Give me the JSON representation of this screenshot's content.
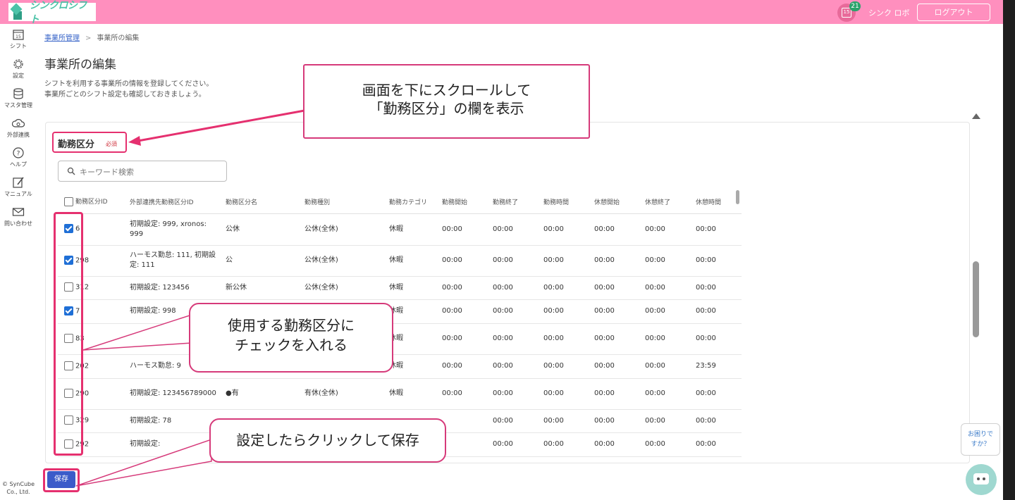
{
  "header": {
    "app_name": "シンクロシフト",
    "notification_count": "21",
    "calendar_day": "15",
    "user_name": "シンク ロボ",
    "logout_label": "ログアウト"
  },
  "sidebar": {
    "items": [
      {
        "label": "シフト",
        "icon": "calendar-icon"
      },
      {
        "label": "設定",
        "icon": "gear-icon"
      },
      {
        "label": "マスタ管理",
        "icon": "database-icon"
      },
      {
        "label": "外部連携",
        "icon": "cloud-sync-icon"
      },
      {
        "label": "ヘルプ",
        "icon": "help-icon"
      },
      {
        "label": "マニュアル",
        "icon": "manual-icon"
      },
      {
        "label": "問い合わせ",
        "icon": "mail-icon"
      }
    ],
    "calendar_day": "15",
    "copyright_line1": "© SynCube",
    "copyright_line2": "Co., Ltd."
  },
  "breadcrumb": {
    "parent": "事業所管理",
    "separator": ">",
    "current": "事業所の編集"
  },
  "page": {
    "title": "事業所の編集",
    "desc_line1": "シフトを利用する事業所の情報を登録してください。",
    "desc_line2": "事業所ごとのシフト設定も確認しておきましょう。"
  },
  "section": {
    "label": "勤務区分",
    "required": "必須"
  },
  "search": {
    "placeholder": "キーワード検索"
  },
  "table": {
    "headers": [
      "勤務区分ID",
      "外部連携先勤務区分ID",
      "勤務区分名",
      "勤務種別",
      "勤務カテゴリ",
      "勤務開始",
      "勤務終了",
      "勤務時間",
      "休憩開始",
      "休憩終了",
      "休憩時間"
    ],
    "rows": [
      {
        "checked": true,
        "id": "6",
        "ext": "初期設定: 999, xronos: 999",
        "name": "公休",
        "type": "公休(全休)",
        "cat": "休暇",
        "ws": "00:00",
        "we": "00:00",
        "wt": "00:00",
        "bs": "00:00",
        "be": "00:00",
        "bt": "00:00"
      },
      {
        "checked": true,
        "id": "298",
        "ext": "ハーモス勤怠: 111, 初期設定: 111",
        "name": "公",
        "type": "公休(全休)",
        "cat": "休暇",
        "ws": "00:00",
        "we": "00:00",
        "wt": "00:00",
        "bs": "00:00",
        "be": "00:00",
        "bt": "00:00"
      },
      {
        "checked": false,
        "id": "312",
        "ext": "初期設定: 123456",
        "name": "新公休",
        "type": "公休(全休)",
        "cat": "休暇",
        "ws": "00:00",
        "we": "00:00",
        "wt": "00:00",
        "bs": "00:00",
        "be": "00:00",
        "bt": "00:00"
      },
      {
        "checked": true,
        "id": "7",
        "ext": "初期設定: 998",
        "name": "",
        "type": "",
        "cat": "休暇",
        "ws": "00:00",
        "we": "00:00",
        "wt": "00:00",
        "bs": "00:00",
        "be": "00:00",
        "bt": "00:00"
      },
      {
        "checked": false,
        "id": "83",
        "ext": "ハーモス勤",
        "name": "",
        "type": "",
        "cat": "休暇",
        "ws": "00:00",
        "we": "00:00",
        "wt": "00:00",
        "bs": "00:00",
        "be": "00:00",
        "bt": "00:00"
      },
      {
        "checked": false,
        "id": "202",
        "ext": "ハーモス勤怠: 9",
        "name": "",
        "type": "",
        "cat": "休暇",
        "ws": "00:00",
        "we": "00:00",
        "wt": "00:00",
        "bs": "00:00",
        "be": "00:00",
        "bt": "23:59"
      },
      {
        "checked": false,
        "id": "290",
        "ext": "初期設定: 123456789000",
        "name": "●有",
        "type": "有休(全休)",
        "cat": "休暇",
        "ws": "00:00",
        "we": "00:00",
        "wt": "00:00",
        "bs": "00:00",
        "be": "00:00",
        "bt": "00:00"
      },
      {
        "checked": false,
        "id": "329",
        "ext": "初期設定: 78",
        "name": "",
        "type": "",
        "cat": "",
        "ws": "",
        "we": "00:00",
        "wt": "00:00",
        "bs": "00:00",
        "be": "00:00",
        "bt": "00:00"
      },
      {
        "checked": false,
        "id": "292",
        "ext": "初期設定:",
        "name": "",
        "type": "",
        "cat": "",
        "ws": "",
        "we": "00:00",
        "wt": "00:00",
        "bs": "00:00",
        "be": "00:00",
        "bt": "00:00"
      }
    ]
  },
  "save_label": "保存",
  "help_bubble": {
    "line1": "お困りで",
    "line2": "すか？"
  },
  "annotations": {
    "scroll_line1": "画面を下にスクロールして",
    "scroll_line2": "「勤務区分」の欄を表示",
    "check_line1": "使用する勤務区分に",
    "check_line2": "チェックを入れる",
    "save_note": "設定したらクリックして保存"
  },
  "colors": {
    "header_bg": "#ff8fbe",
    "accent": "#3b5bc9",
    "annotation": "#e5306f"
  }
}
